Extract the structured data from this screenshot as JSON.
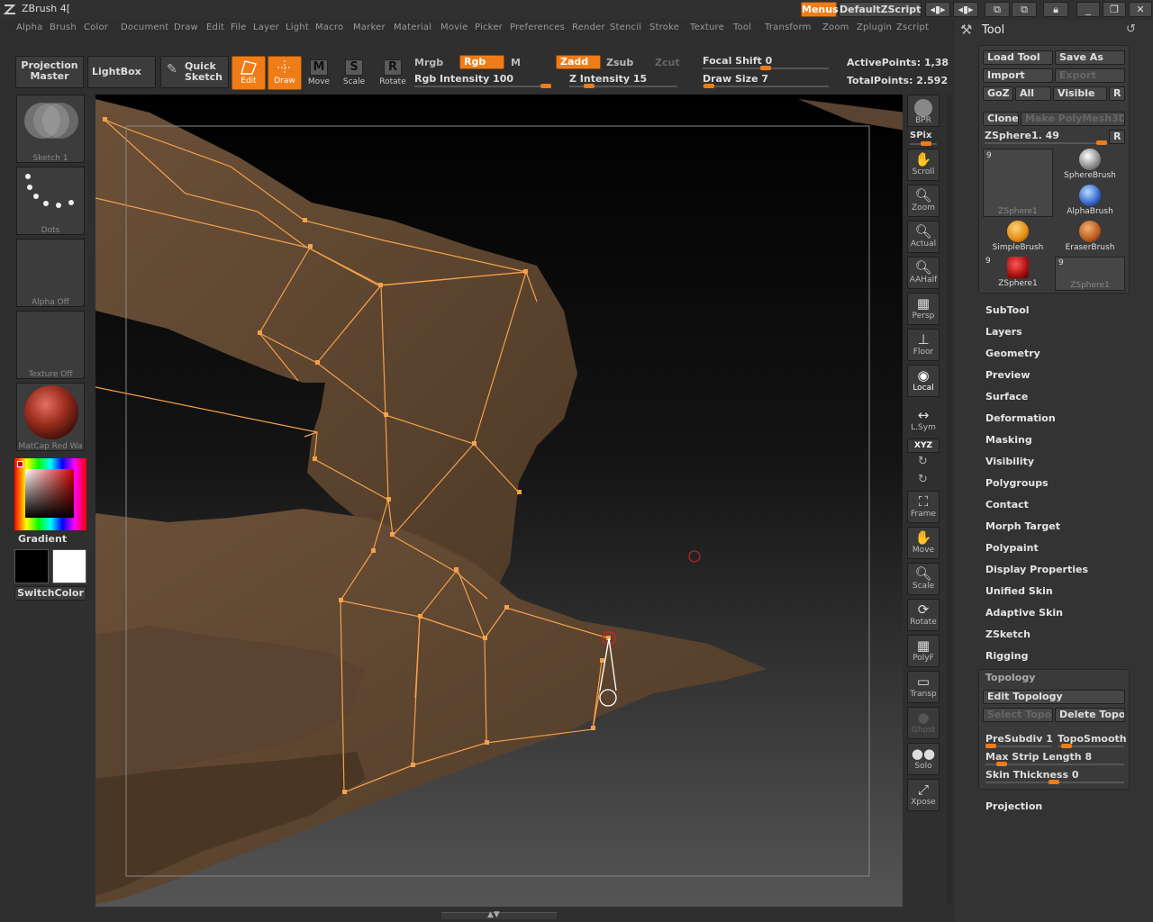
{
  "app": {
    "title": "ZBrush 4[",
    "menus_btn": "Menus",
    "script_btn": "DefaultZScript"
  },
  "menubar": [
    "Alpha",
    "Brush",
    "Color",
    "Document",
    "Draw",
    "Edit",
    "File",
    "Layer",
    "Light",
    "Macro",
    "Marker",
    "Material",
    "Movie",
    "Picker",
    "Preferences",
    "Render",
    "Stencil",
    "Stroke",
    "Texture",
    "Tool",
    "Transform",
    "Zoom",
    "Zplugin",
    "Zscript"
  ],
  "shelf": {
    "projection_master": "Projection Master",
    "lightbox": "LightBox",
    "quick_sketch": "Quick Sketch",
    "edit": "Edit",
    "draw": "Draw",
    "move": "Move",
    "scale": "Scale",
    "rotate": "Rotate",
    "move_key": "M",
    "scale_key": "S",
    "rotate_key": "R",
    "mrgb": "Mrgb",
    "rgb": "Rgb",
    "m": "M",
    "zadd": "Zadd",
    "zsub": "Zsub",
    "zcut": "Zcut",
    "rgb_intensity": "Rgb Intensity 100",
    "z_intensity": "Z Intensity 15",
    "focal_shift": "Focal Shift 0",
    "draw_size": "Draw Size 7",
    "active_points": "ActivePoints: 1,38",
    "total_points": "TotalPoints: 2.592",
    "rgb_intensity_value": 100,
    "z_intensity_value": 15,
    "focal_shift_value": 0,
    "draw_size_value": 7
  },
  "leftbar": {
    "sketch": "Sketch 1",
    "dots": "Dots",
    "alpha": "Alpha Off",
    "texture": "Texture Off",
    "matcap": "MatCap Red Wa",
    "gradient": "Gradient",
    "switchcolor": "SwitchColor"
  },
  "rightstrip": [
    "BPR",
    "SPix",
    "Scroll",
    "Zoom",
    "Actual",
    "AAHalf",
    "Persp",
    "Floor",
    "Local",
    "L.Sym",
    "XYZ",
    "Frame",
    "Move",
    "Scale",
    "Rotate",
    "PolyF",
    "Transp",
    "Ghost",
    "Solo",
    "Xpose"
  ],
  "tool_panel": {
    "title": "Tool",
    "load_tool": "Load Tool",
    "save_as": "Save As",
    "import": "Import",
    "export": "Export",
    "goz": "GoZ",
    "all": "All",
    "visible": "Visible",
    "r": "R",
    "clone": "Clone",
    "make_polymesh": "Make PolyMesh3D",
    "zsphere_slider": "ZSphere1. 49",
    "thumbs": [
      {
        "name": "ZSphere1",
        "count": "9"
      },
      {
        "name": "SphereBrush",
        "count": ""
      },
      {
        "name": "AlphaBrush",
        "count": ""
      },
      {
        "name": "SimpleBrush",
        "count": ""
      },
      {
        "name": "EraserBrush",
        "count": ""
      },
      {
        "name": "ZSphere1",
        "count": "9"
      },
      {
        "name": "ZSphere1",
        "count": "9"
      }
    ],
    "sections": [
      "SubTool",
      "Layers",
      "Geometry",
      "Preview",
      "Surface",
      "Deformation",
      "Masking",
      "Visibility",
      "Polygroups",
      "Contact",
      "Morph Target",
      "Polypaint",
      "Display Properties",
      "Unified Skin",
      "Adaptive Skin",
      "ZSketch",
      "Rigging"
    ],
    "topology": {
      "title": "Topology",
      "edit_topology": "Edit Topology",
      "select_topo": "Select Topo",
      "delete_topo": "Delete Topo",
      "presubdiv": "PreSubdiv 1",
      "toposmooth": "TopoSmooth",
      "max_strip": "Max Strip Length 8",
      "skin_thickness": "Skin Thickness 0"
    },
    "projection": "Projection"
  },
  "colors": {
    "accent": "#f07c18",
    "model": "#5e4630",
    "topo_line": "#f5a04a"
  }
}
